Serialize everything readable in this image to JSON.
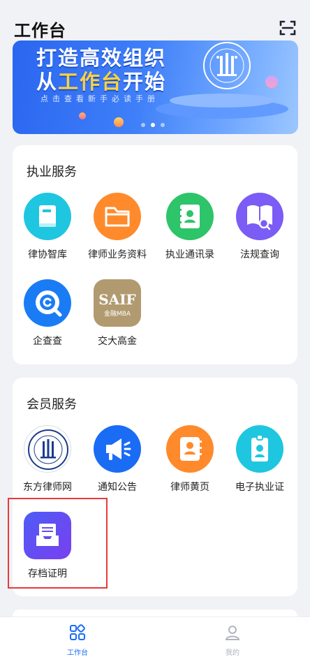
{
  "header": {
    "title": "工作台",
    "scan_icon": "scan-icon"
  },
  "banner": {
    "line1": "打造高效组织",
    "line2_prefix": "从",
    "line2_highlight": "工作台",
    "line2_suffix": "开始",
    "subtitle": "点击查看新手必读手册",
    "page_count": 3,
    "active_page": 2,
    "colors": {
      "background": "#3f7ff8",
      "highlight": "#ffd23f"
    }
  },
  "practice_services": {
    "title": "执业服务",
    "items": [
      {
        "label": "律协智库",
        "icon": "book-icon",
        "color": "#1fc6e0"
      },
      {
        "label": "律师业务资料",
        "icon": "folder-icon",
        "color": "#ff8a2b"
      },
      {
        "label": "执业通讯录",
        "icon": "contact-book-icon",
        "color": "#2ec46a"
      },
      {
        "label": "法规查询",
        "icon": "book-search-icon",
        "color": "#7b5cf5"
      },
      {
        "label": "企查查",
        "icon": "qichacha-logo-icon",
        "color": "#1a7cf5"
      },
      {
        "label": "交大高金",
        "icon": "saif-logo-icon",
        "color": "#b29a70",
        "logo_text": "SAIF",
        "logo_subtext": "金融MBA"
      }
    ]
  },
  "member_services": {
    "title": "会员服务",
    "items": [
      {
        "label": "东方律师网",
        "icon": "bar-association-emblem-icon",
        "color": "#1a3b8c"
      },
      {
        "label": "通知公告",
        "icon": "megaphone-icon",
        "color": "#1a6cf5"
      },
      {
        "label": "律师黄页",
        "icon": "address-book-icon",
        "color": "#ff8a2b"
      },
      {
        "label": "电子执业证",
        "icon": "id-badge-icon",
        "color": "#1fc6e0"
      },
      {
        "label": "存档证明",
        "icon": "archive-tray-icon",
        "color": "#6a4df0"
      }
    ]
  },
  "tabbar": {
    "tabs": [
      {
        "label": "工作台",
        "icon": "grid-icon",
        "active": true,
        "color": "#1a6cf5"
      },
      {
        "label": "我的",
        "icon": "person-icon",
        "active": false,
        "color": "#b0b4bc"
      }
    ]
  }
}
